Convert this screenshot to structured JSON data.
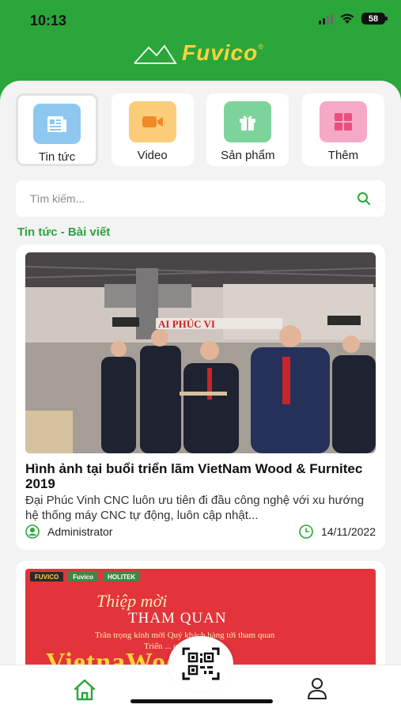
{
  "status_bar": {
    "time": "10:13",
    "battery": "58"
  },
  "brand": {
    "name": "Fuvico",
    "reg": "®",
    "accent": "#2aa63a",
    "logo_color": "#ffd23a"
  },
  "categories": [
    {
      "label": "Tin tức",
      "icon": "newspaper-icon",
      "color": "#8ec8f0",
      "active": true
    },
    {
      "label": "Video",
      "icon": "video-camera-icon",
      "color": "#fbcd7a",
      "active": false
    },
    {
      "label": "Sản phẩm",
      "icon": "gift-icon",
      "color": "#7dd49a",
      "active": false
    },
    {
      "label": "Thêm",
      "icon": "grid-icon",
      "color": "#f6a9c6",
      "active": false
    }
  ],
  "search": {
    "placeholder": "Tìm kiếm..."
  },
  "section": {
    "title": "Tin tức - Bài viết"
  },
  "posts": [
    {
      "image": "exhibition-photo",
      "title": "Hình ảnh tại buổi triển lãm VietNam Wood & Furnitec 2019",
      "excerpt": "Đại Phúc Vinh CNC luôn ưu tiên đi đầu công nghệ với xu hướng hệ thống máy CNC tự động, luôn cập nhật...",
      "author": "Administrator",
      "date": "14/11/2022"
    },
    {
      "image": "invitation-banner",
      "banner": {
        "logos": [
          "FUVICO",
          "Fuvico",
          "HOLITEK"
        ],
        "line1": "Thiệp mời",
        "line2": "THAM QUAN",
        "line3": "Trân trọng kính mời Quý khách hàng tới tham quan",
        "line4": "Triển ... quốc tế",
        "line5": "VietnaWood"
      }
    }
  ],
  "bottom_nav": {
    "home": "home-icon",
    "scan": "qr-code-icon",
    "profile": "user-icon"
  }
}
